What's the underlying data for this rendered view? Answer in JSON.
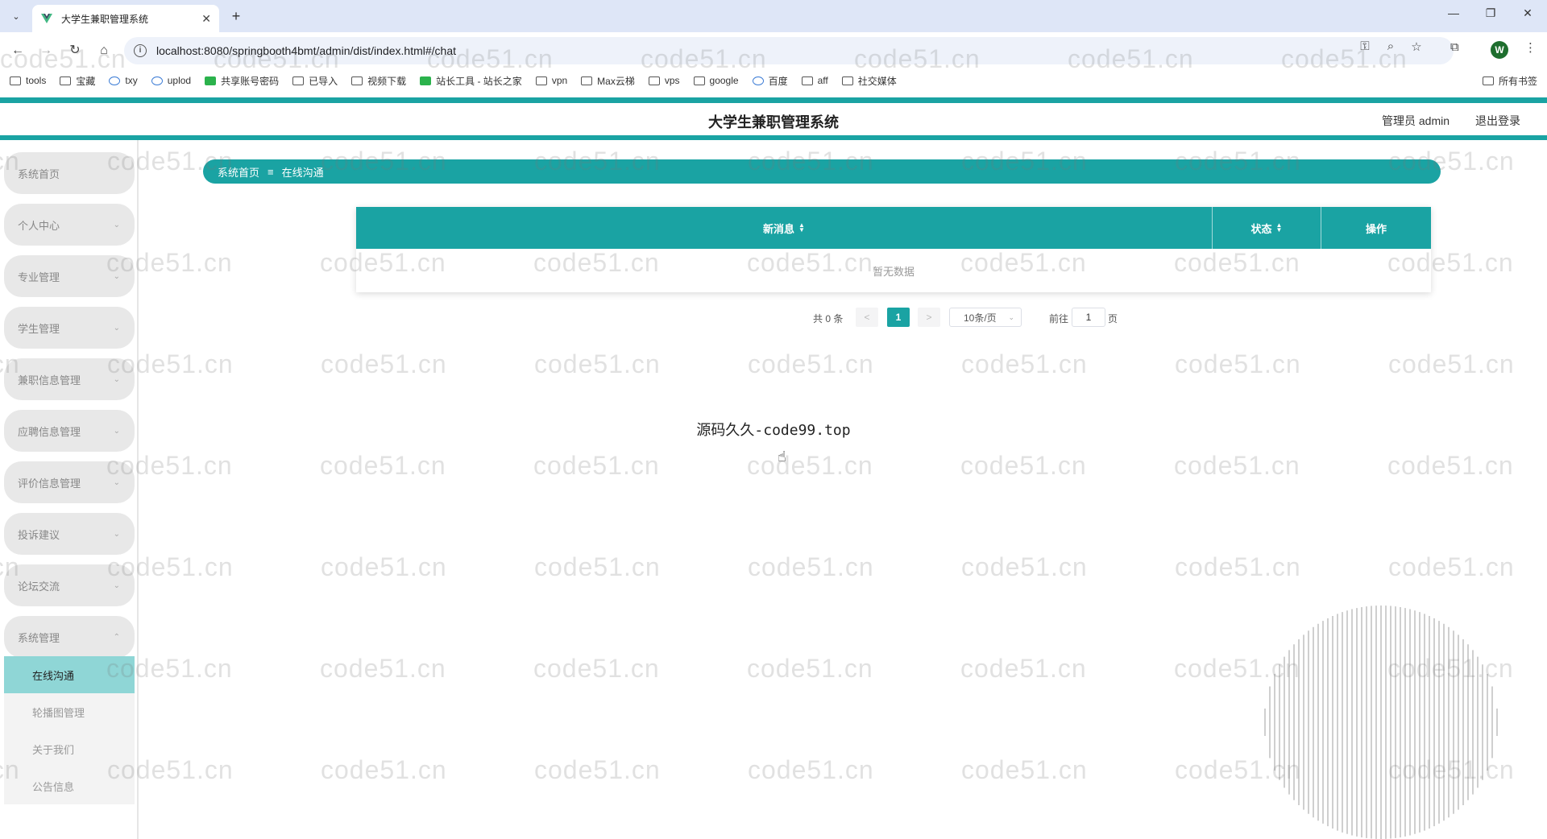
{
  "browser": {
    "tab_title": "大学生兼职管理系统",
    "url": "localhost:8080/springbooth4bmt/admin/dist/index.html#/chat",
    "profile_initial": "W",
    "bookmarks": [
      "tools",
      "宝藏",
      "txy",
      "uplod",
      "共享账号密码",
      "已导入",
      "视频下载",
      "站长工具 - 站长之家",
      "vpn",
      "Max云梯",
      "vps",
      "google",
      "百度",
      "aff",
      "社交媒体"
    ],
    "all_bookmarks": "所有书签"
  },
  "header": {
    "title": "大学生兼职管理系统",
    "user": "管理员 admin",
    "logout": "退出登录"
  },
  "sidebar": {
    "items": [
      {
        "label": "系统首页",
        "chevron": ""
      },
      {
        "label": "个人中心",
        "chevron": "⌄"
      },
      {
        "label": "专业管理",
        "chevron": "⌄"
      },
      {
        "label": "学生管理",
        "chevron": "⌄"
      },
      {
        "label": "兼职信息管理",
        "chevron": "⌄"
      },
      {
        "label": "应聘信息管理",
        "chevron": "⌄"
      },
      {
        "label": "评价信息管理",
        "chevron": "⌄"
      },
      {
        "label": "投诉建议",
        "chevron": "⌄"
      },
      {
        "label": "论坛交流",
        "chevron": "⌄"
      },
      {
        "label": "系统管理",
        "chevron": "⌃"
      }
    ],
    "subitems": [
      "在线沟通",
      "轮播图管理",
      "关于我们",
      "公告信息"
    ]
  },
  "breadcrumb": {
    "home": "系统首页",
    "sep": "≡",
    "current": "在线沟通"
  },
  "table": {
    "columns": [
      "新消息",
      "状态",
      "操作"
    ],
    "empty_text": "暂无数据"
  },
  "pagination": {
    "total": "共 0 条",
    "prev": "<",
    "page": "1",
    "next": ">",
    "page_size": "10条/页",
    "goto_label": "前往",
    "goto_value": "1",
    "goto_suffix": "页"
  },
  "promo_text": "源码久久-code99.top",
  "watermark": "code51.cn",
  "colors": {
    "accent": "#1aa3a3",
    "active_sub": "#8fd6d6",
    "chrome": "#dee6f7"
  }
}
